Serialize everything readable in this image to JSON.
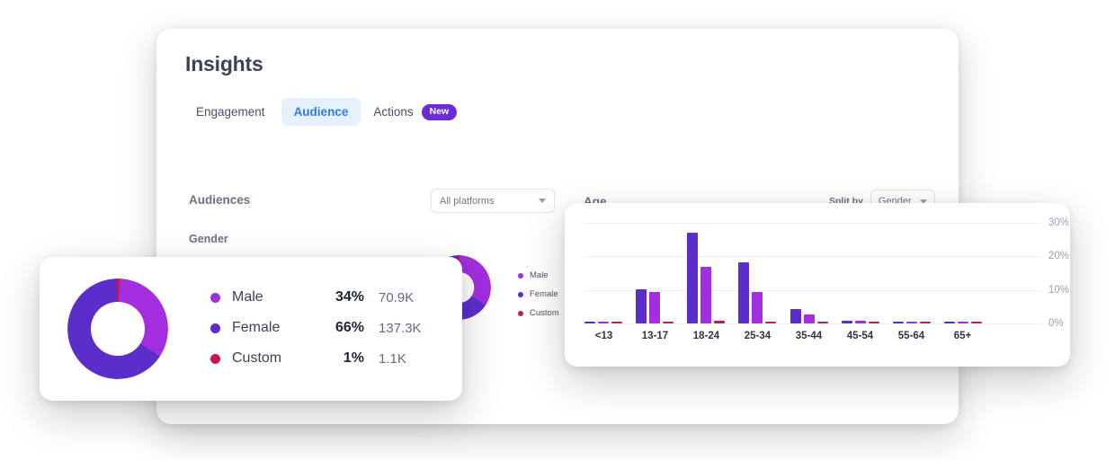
{
  "panel": {
    "title": "Insights",
    "tabs": [
      {
        "label": "Engagement",
        "active": false
      },
      {
        "label": "Audience",
        "active": true
      }
    ],
    "actions_tab": {
      "label": "Actions",
      "badge": "New"
    }
  },
  "audiences": {
    "section_label": "Audiences",
    "gender_label": "Gender",
    "platform_select": {
      "value": "All platforms"
    }
  },
  "age": {
    "section_label": "Age",
    "split_by_label": "Split by",
    "split_select": {
      "value": "Gender"
    }
  },
  "gender_legend": [
    {
      "name": "Male",
      "percent": "34%",
      "value": "70.9K",
      "color": "#a22ee0"
    },
    {
      "name": "Female",
      "percent": "66%",
      "value": "137.3K",
      "color": "#5b2ecc"
    },
    {
      "name": "Custom",
      "percent": "1%",
      "value": "1.1K",
      "color": "#c2185b"
    }
  ],
  "colors": {
    "female": "#5b2ecc",
    "male": "#a22ee0",
    "custom": "#b3235a",
    "accent_blue": "#2f7bf6",
    "badge_purple": "#6c2bd9"
  },
  "chart_data": [
    {
      "type": "pie",
      "title": "Gender",
      "labels": [
        "Male",
        "Female",
        "Custom"
      ],
      "values": [
        34,
        66,
        1
      ],
      "counts": [
        "70.9K",
        "137.3K",
        "1.1K"
      ],
      "colors": [
        "#a22ee0",
        "#5b2ecc",
        "#c2185b"
      ],
      "donut": true,
      "legend_position": "right"
    },
    {
      "type": "bar",
      "title": "Age",
      "categories": [
        "<13",
        "13-17",
        "18-24",
        "25-34",
        "35-44",
        "45-54",
        "55-64",
        "65+"
      ],
      "series": [
        {
          "name": "Female",
          "color": "#5b2ecc",
          "values": [
            0.6,
            10.3,
            27.0,
            18.2,
            4.3,
            0.8,
            0.6,
            0.6
          ]
        },
        {
          "name": "Male",
          "color": "#a22ee0",
          "values": [
            0.5,
            9.4,
            16.8,
            9.3,
            2.6,
            0.9,
            0.5,
            0.5
          ]
        },
        {
          "name": "Custom",
          "color": "#b3235a",
          "values": [
            0.4,
            0.4,
            0.7,
            0.4,
            0.4,
            0.4,
            0.4,
            0.4
          ]
        }
      ],
      "ylabel": "",
      "xlabel": "",
      "ylim": [
        0,
        30
      ],
      "yticks": [
        "0%",
        "10%",
        "20%",
        "30%"
      ],
      "ytick_values": [
        0,
        10,
        20,
        30
      ],
      "grid": true,
      "legend_position": "none"
    }
  ]
}
